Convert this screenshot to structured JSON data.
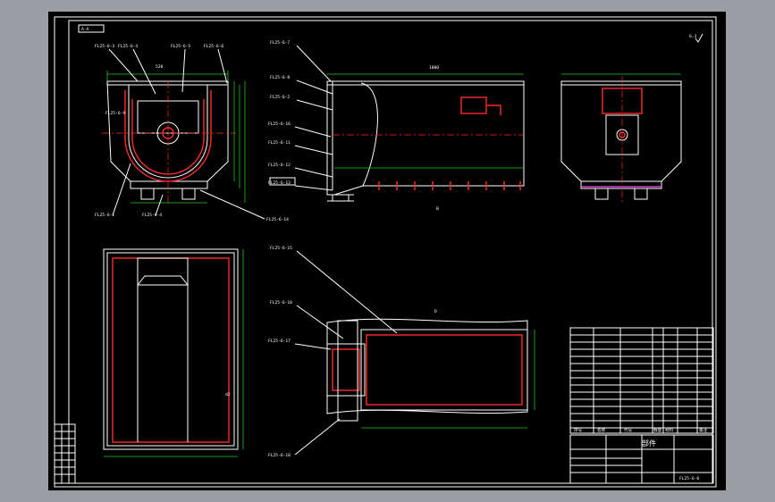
{
  "colors": {
    "sheet_bg": "#000000",
    "frame": "#ffffff",
    "dims": "#21c821",
    "hidden": "#ff2b2b",
    "accent": "#d63bd6"
  },
  "view_label": "A-A",
  "detail_label": "D",
  "section_marks": {
    "front": "B",
    "top": "B"
  },
  "front_view_leaders": [
    "FL25-6-3",
    "FL25-6-4",
    "FL25-6-5",
    "FL25-6-6",
    "FL25-6-9",
    "FL25-6-1",
    "FL25-6-14"
  ],
  "side_view_leaders": [
    "FL25-6-7",
    "FL25-6-8",
    "FL25-6-2",
    "FL25-6-16",
    "FL25-6-11",
    "FL25-6-12",
    "FL25-6-13"
  ],
  "top_view_leaders": [
    "FL25-6-15",
    "FL25-6-10",
    "FL25-6-17",
    "FL25-6-18"
  ],
  "roughness": "6.3",
  "sheet_number": "FL25-6-0",
  "title_block": {
    "name": "部件"
  },
  "parts_table_header": [
    "序号",
    "名称",
    "代号",
    "数量",
    "材料",
    "备注"
  ]
}
